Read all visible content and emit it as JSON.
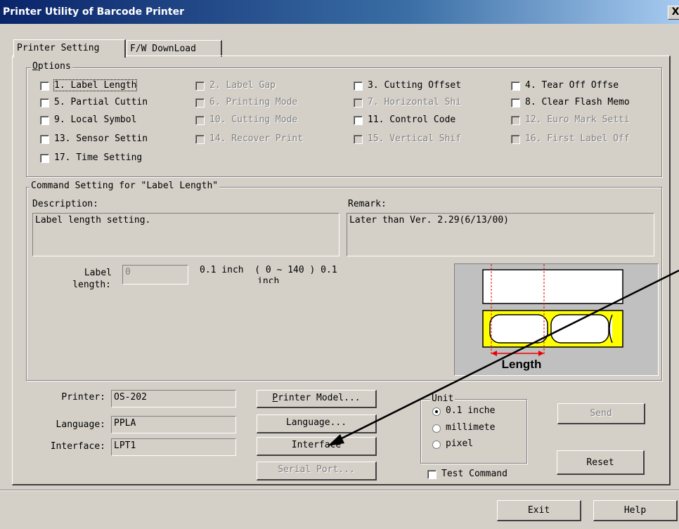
{
  "window": {
    "title": "Printer Utility of Barcode Printer",
    "close": "X"
  },
  "tabs": [
    "Printer Setting",
    "F/W DownLoad"
  ],
  "options": {
    "legend": "Options",
    "items": [
      {
        "label": "1. Label Length",
        "enabled": true
      },
      {
        "label": "2. Label Gap",
        "enabled": false
      },
      {
        "label": "3. Cutting Offset",
        "enabled": true
      },
      {
        "label": "4. Tear Off Offse",
        "enabled": true
      },
      {
        "label": "5. Partial Cuttin",
        "enabled": true
      },
      {
        "label": "6. Printing Mode",
        "enabled": false
      },
      {
        "label": "7. Horizontal Shi",
        "enabled": false
      },
      {
        "label": "8. Clear Flash Memo",
        "enabled": true
      },
      {
        "label": "9. Local Symbol",
        "enabled": true
      },
      {
        "label": "10. Cutting Mode",
        "enabled": false
      },
      {
        "label": "11. Control Code",
        "enabled": true
      },
      {
        "label": "12. Euro Mark Setti",
        "enabled": false
      },
      {
        "label": "13. Sensor Settin",
        "enabled": true
      },
      {
        "label": "14. Recover Print",
        "enabled": false
      },
      {
        "label": "15. Vertical Shif",
        "enabled": false
      },
      {
        "label": "16. First Label Off",
        "enabled": false
      },
      {
        "label": "17. Time Setting",
        "enabled": true
      }
    ]
  },
  "command": {
    "legend": "Command Setting for \"Label Length\"",
    "description_label": "Description:",
    "description": "Label length setting.",
    "remark_label": "Remark:",
    "remark": "Later than Ver. 2.29(6/13/00)",
    "field_label_1": "Label",
    "field_label_2": "length:",
    "field_value": "0",
    "range_text": "0.1 inch  ( 0 ~ 140 ) 0.1",
    "range_text_2": "inch",
    "diagram_caption": "Length"
  },
  "info": {
    "printer_label": "Printer:",
    "printer_value": "OS-202",
    "language_label": "Language:",
    "language_value": "PPLA",
    "interface_label": "Interface:",
    "interface_value": "LPT1"
  },
  "buttons": {
    "printer_model": "Printer Model...",
    "language": "Language...",
    "interface": "Interface",
    "serial_port": "Serial Port...",
    "send": "Send",
    "reset": "Reset",
    "exit": "Exit",
    "help": "Help"
  },
  "unit": {
    "legend": "Unit",
    "options": [
      "0.1 inche",
      "millimete",
      "pixel"
    ],
    "selected_index": 0
  },
  "test_command": "Test Command"
}
